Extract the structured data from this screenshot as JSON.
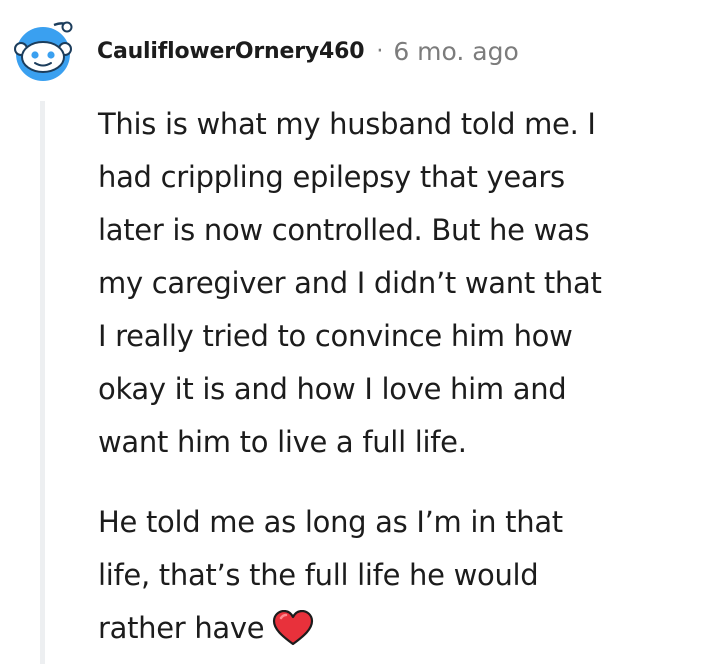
{
  "comment": {
    "username": "CauliflowerOrnery460",
    "separator": "·",
    "timestamp": "6 mo. ago",
    "avatar_icon": "reddit-snoo-avatar-icon",
    "paragraphs": [
      {
        "lines": [
          "This is what my husband told me. I",
          "had crippling epilepsy that years",
          "later is now controlled. But he was",
          "my caregiver and I didn’t want that",
          "I really tried to convince him how",
          "okay it is and how I love him and",
          "want him to live a full life."
        ]
      },
      {
        "lines": [
          "He told me as long as I’m in that",
          "life, that’s the full life he would",
          "rather have"
        ],
        "trailing_icon": "red-heart-emoji-icon"
      }
    ]
  },
  "colors": {
    "text": "#1c1c1c",
    "meta": "#7c7c7c",
    "thread_line": "#edeff1",
    "avatar_blue": "#3aa0f0",
    "heart_red": "#e8313b"
  }
}
